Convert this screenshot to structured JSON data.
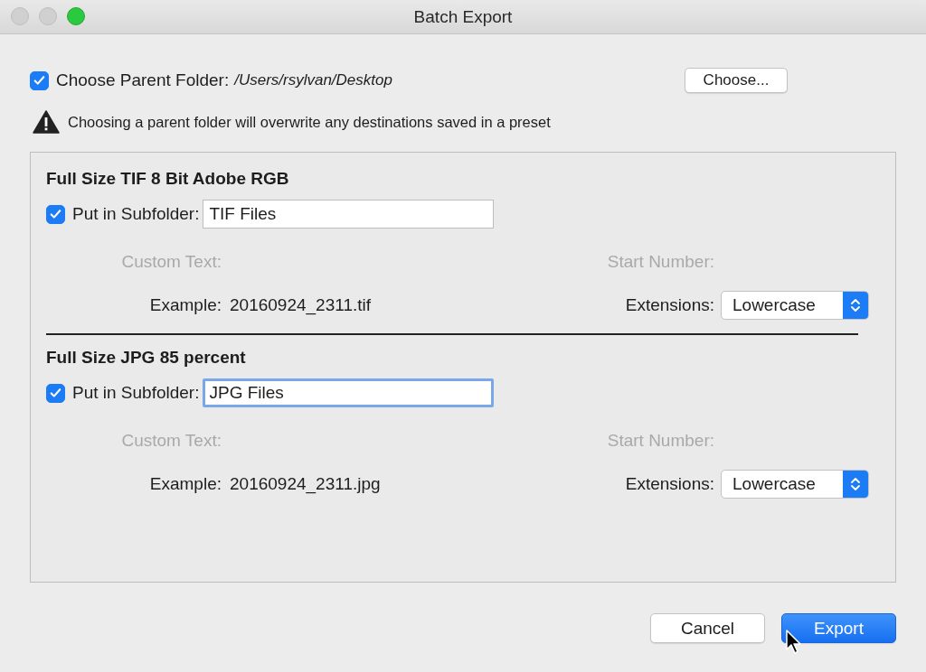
{
  "window": {
    "title": "Batch Export"
  },
  "parent_folder": {
    "label": "Choose Parent Folder:",
    "checked": true,
    "path": "/Users/rsylvan/Desktop",
    "button": "Choose..."
  },
  "warning": "Choosing a parent folder will overwrite any destinations saved in a preset",
  "presets": [
    {
      "title": "Full Size TIF 8 Bit Adobe RGB",
      "subfolder": {
        "label": "Put in Subfolder:",
        "checked": true,
        "value": "TIF Files",
        "focused": false
      },
      "custom_text": {
        "label": "Custom Text:",
        "disabled": true
      },
      "start_number": {
        "label": "Start Number:",
        "disabled": true
      },
      "example_label": "Example:",
      "example": "20160924_2311.tif",
      "extensions_label": "Extensions:",
      "extensions": "Lowercase"
    },
    {
      "title": "Full Size JPG 85 percent",
      "subfolder": {
        "label": "Put in Subfolder:",
        "checked": true,
        "value": "JPG Files",
        "focused": true
      },
      "custom_text": {
        "label": "Custom Text:",
        "disabled": true
      },
      "start_number": {
        "label": "Start Number:",
        "disabled": true
      },
      "example_label": "Example:",
      "example": "20160924_2311.jpg",
      "extensions_label": "Extensions:",
      "extensions": "Lowercase"
    }
  ],
  "buttons": [
    {
      "label": "Cancel",
      "default": false
    },
    {
      "label": "Export",
      "default": true
    }
  ]
}
